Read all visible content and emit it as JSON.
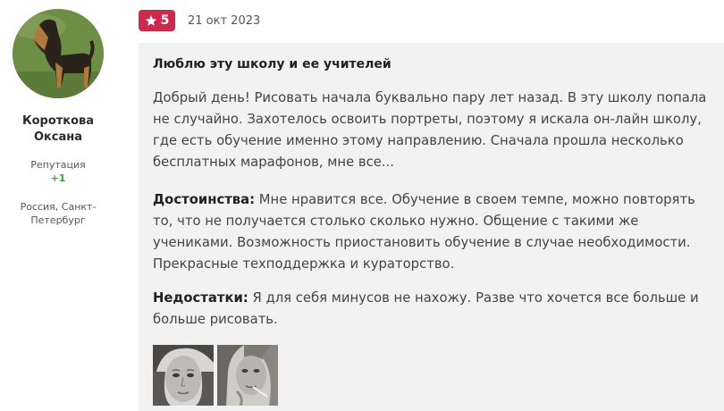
{
  "author": {
    "name": "Короткова Оксана",
    "reputation_label": "Репутация",
    "reputation_value": "+1",
    "location": "Россия, Санкт-Петербург"
  },
  "review": {
    "rating": "5",
    "date": "21 окт 2023",
    "title": "Люблю эту школу и ее учителей",
    "text": "Добрый день! Рисовать начала буквально пару лет назад. В эту школу попала не случайно. Захотелось освоить портреты, поэтому я искала он-лайн школу, где есть обучение именно этому направлению. Сначала прошла несколько бесплатных марафонов, мне все...",
    "pros_label": "Достоинства:",
    "pros_text": " Мне нравится все. Обучение в своем темпе, можно повторять то, что не получается столько сколько нужно. Общение с такими же учениками. Возможность приостановить обучение в случае необходимости. Прекрасные техподдержка и кураторство.",
    "cons_label": "Недостатки:",
    "cons_text": " Я для себя минусов не нахожу. Разве что хочется все больше и больше рисовать."
  },
  "colors": {
    "badge": "#cb2a4f",
    "reputation_positive": "#3aa635",
    "card_background": "#f2f2f2"
  },
  "icons": {
    "rating": "star-icon"
  }
}
